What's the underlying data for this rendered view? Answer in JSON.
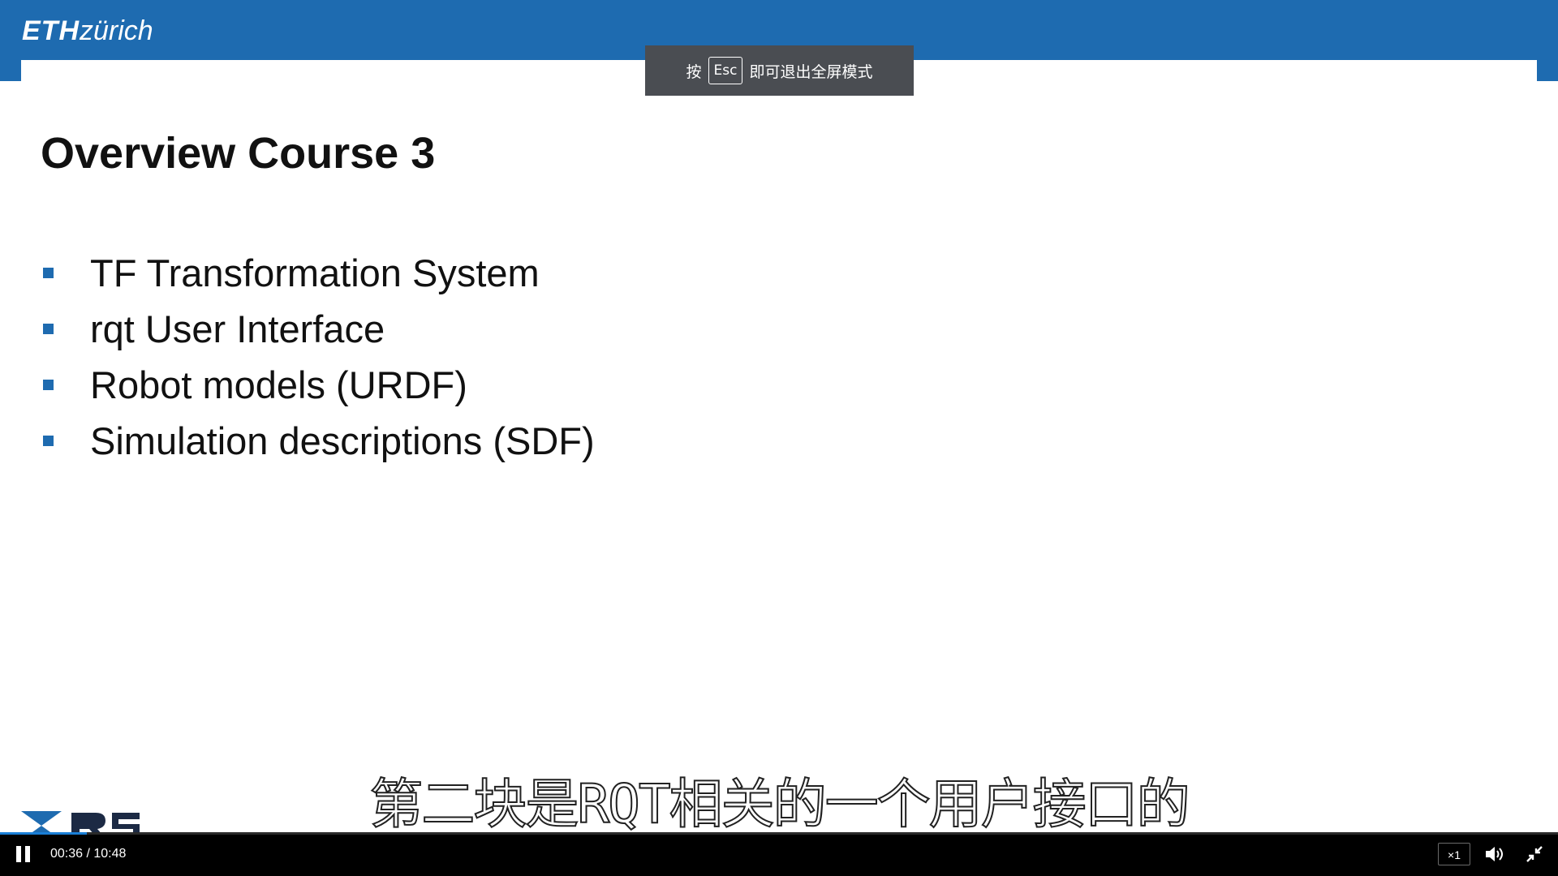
{
  "header": {
    "logo_bold": "ETH",
    "logo_light": "zürich",
    "accent_color": "#1e6bb0"
  },
  "toast": {
    "prefix": "按",
    "key": "Esc",
    "suffix": "即可退出全屏模式"
  },
  "slide": {
    "title": "Overview Course 3",
    "bullets": [
      "TF Transformation System",
      "rqt User Interface",
      "Robot models (URDF)",
      "Simulation descriptions (SDF)"
    ],
    "bullet_color": "#1e6bb0"
  },
  "subtitle": "第二块是RQT相关的一个用户接口的",
  "player": {
    "time_current": "00:36",
    "time_total": "10:48",
    "time_display": "00:36 / 10:48",
    "speed_label": "×1",
    "progress_fraction": 0.0556,
    "icons": {
      "play_state": "pause-icon",
      "volume": "volume-icon",
      "fullscreen": "exit-fullscreen-icon"
    }
  }
}
